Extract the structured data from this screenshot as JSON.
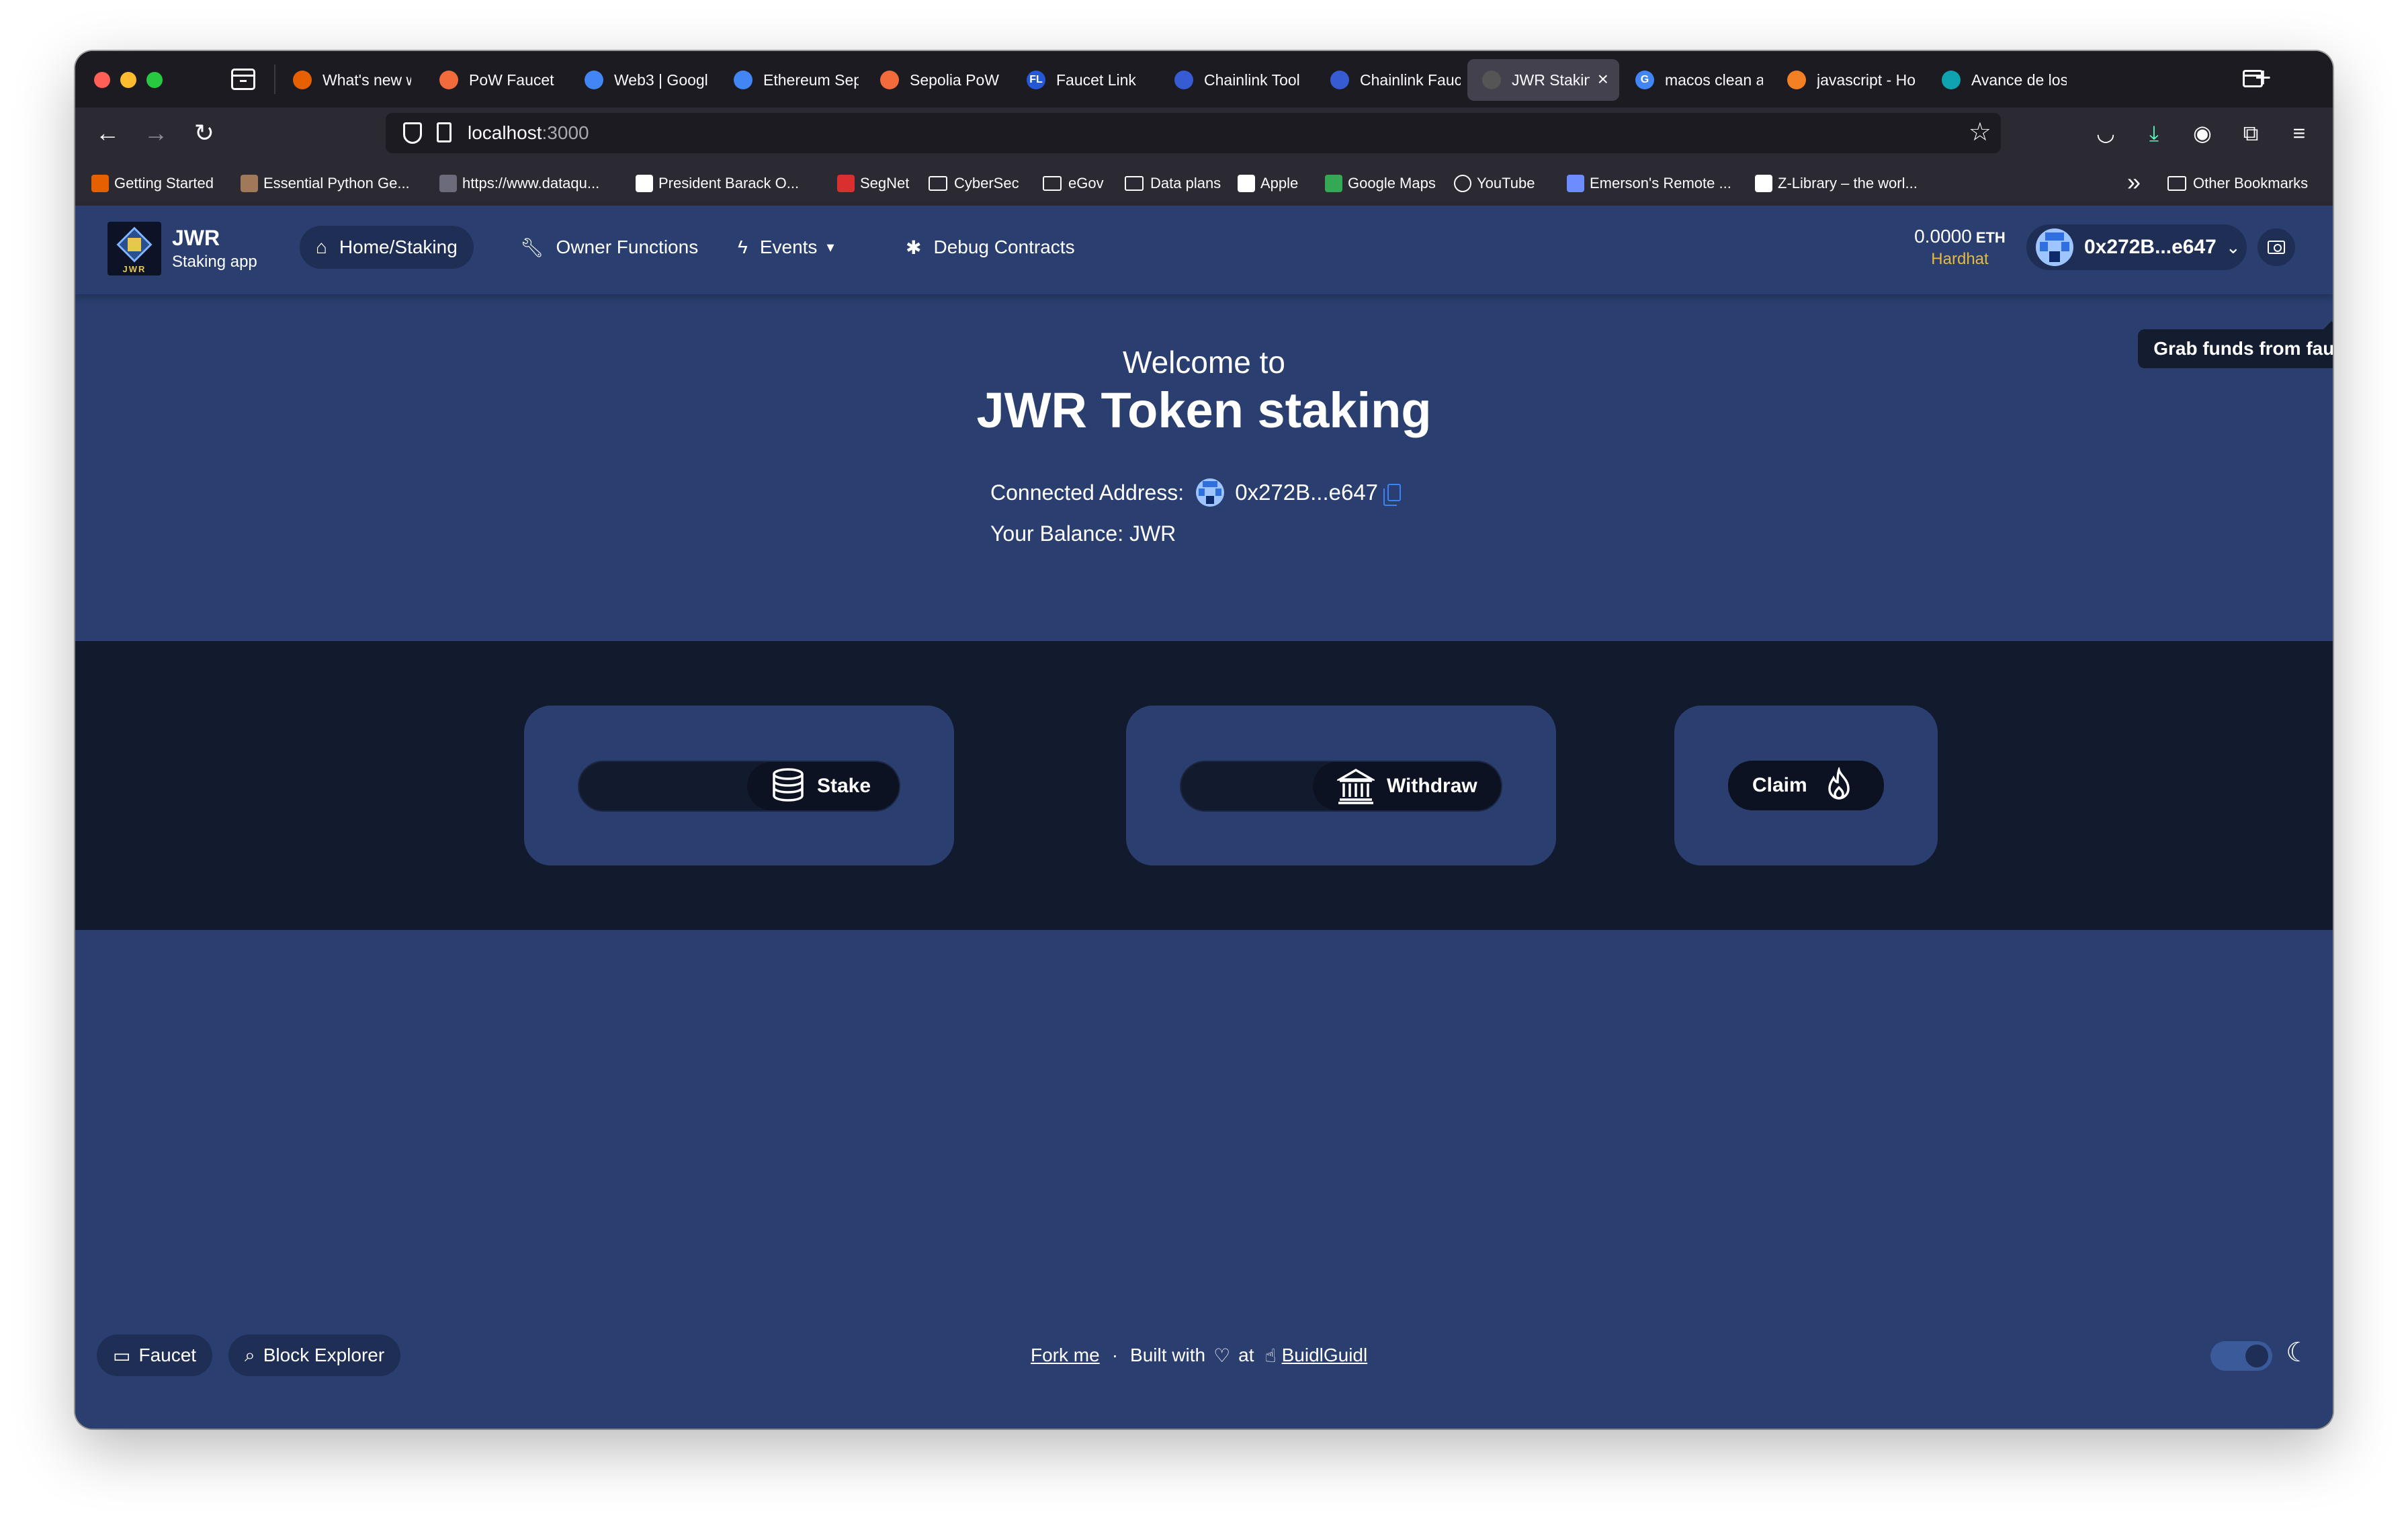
{
  "browser": {
    "tabs": [
      {
        "label": "What's new w",
        "color": "#e66000",
        "glyph": "",
        "active": false
      },
      {
        "label": "PoW Faucet",
        "color": "#f26b3a",
        "glyph": "",
        "active": false
      },
      {
        "label": "Web3 | Googl",
        "color": "#4285f4",
        "glyph": "",
        "active": false
      },
      {
        "label": "Ethereum Sep",
        "color": "#4285f4",
        "glyph": "",
        "active": false
      },
      {
        "label": "Sepolia PoW F",
        "color": "#f26b3a",
        "glyph": "",
        "active": false
      },
      {
        "label": "Faucet Link",
        "color": "#2458d6",
        "glyph": "FL",
        "active": false
      },
      {
        "label": "Chainlink Tool",
        "color": "#375bd2",
        "glyph": "",
        "active": false
      },
      {
        "label": "Chainlink Fauc",
        "color": "#375bd2",
        "glyph": "",
        "active": false
      },
      {
        "label": "JWR Stakin",
        "color": "#555",
        "glyph": "",
        "active": true
      },
      {
        "label": "macos clean a",
        "color": "#4285f4",
        "glyph": "G",
        "active": false
      },
      {
        "label": "javascript - Ho",
        "color": "#f48024",
        "glyph": "",
        "active": false
      },
      {
        "label": "Avance de los",
        "color": "#0fa3b1",
        "glyph": "",
        "active": false
      }
    ],
    "url_host": "localhost",
    "url_port": ":3000",
    "bookmarks": [
      {
        "label": "Getting Started",
        "type": "icon",
        "color": "#e66000"
      },
      {
        "label": "Essential Python Ge...",
        "type": "icon",
        "color": "#a0785a"
      },
      {
        "label": "https://www.dataqu...",
        "type": "icon",
        "color": "#6b6b7b"
      },
      {
        "label": "President Barack O...",
        "type": "icon",
        "color": "#ffffff"
      },
      {
        "label": "SegNet",
        "type": "icon",
        "color": "#d9302f"
      },
      {
        "label": "CyberSec",
        "type": "folder"
      },
      {
        "label": "eGov",
        "type": "folder"
      },
      {
        "label": "Data plans",
        "type": "folder"
      },
      {
        "label": "Apple",
        "type": "icon",
        "color": "#ffffff"
      },
      {
        "label": "Google Maps",
        "type": "icon",
        "color": "#34a853"
      },
      {
        "label": "YouTube",
        "type": "globe"
      },
      {
        "label": "Emerson's Remote ...",
        "type": "icon",
        "color": "#6d8cff"
      },
      {
        "label": "Z-Library – the worl...",
        "type": "icon",
        "color": "#ffffff"
      }
    ],
    "other_bookmarks": "Other Bookmarks"
  },
  "app": {
    "brand": {
      "name": "JWR",
      "subtitle": "Staking app",
      "logo_text": "JWR"
    },
    "menu": [
      {
        "label": "Home/Staking",
        "icon": "home-icon"
      },
      {
        "label": "Owner Functions",
        "icon": "wrench-icon"
      },
      {
        "label": "Events",
        "icon": "bolt-icon"
      },
      {
        "label": "Debug Contracts",
        "icon": "bug-icon"
      }
    ],
    "wallet": {
      "eth_amount": "0.0000",
      "eth_unit": "ETH",
      "network": "Hardhat",
      "address": "0x272B...e647",
      "tooltip": "Grab funds from faucet"
    },
    "hero": {
      "welcome": "Welcome to",
      "title": "JWR Token staking",
      "connected_label": "Connected Address:",
      "connected_address": "0x272B...e647",
      "balance": "Your Balance: JWR"
    },
    "actions": {
      "stake": {
        "label": "Stake",
        "value": ""
      },
      "withdraw": {
        "label": "Withdraw",
        "value": ""
      },
      "claim": {
        "label": "Claim"
      }
    },
    "footer": {
      "faucet": "Faucet",
      "block_explorer": "Block Explorer",
      "fork_me": "Fork me",
      "separator": "·",
      "built_with": "Built with",
      "at": "at",
      "buidlguidl": "BuidlGuidl"
    }
  },
  "colors": {
    "header_bg": "#2a3f6f",
    "actions_bg": "#121a2e",
    "card_bg": "#2a3f6f",
    "network": "#e8b93f",
    "copy_icon": "#3b82f6"
  }
}
